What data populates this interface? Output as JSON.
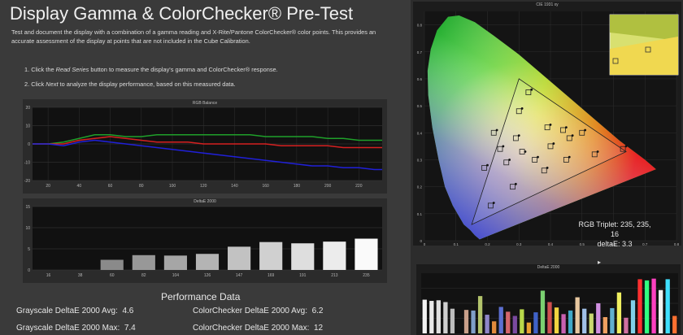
{
  "header": {
    "title": "Display Gamma & ColorChecker® Pre-Test",
    "intro": "Test and document the display with a combination of a gamma reading and X-Rite/Pantone ColorChecker® color points.  This provides an accurate assessment of the display at points that are not included in the Cube Calibration.",
    "step1_prefix": "1. Click the ",
    "step1_link": "Read Series",
    "step1_suffix": " button to measure the display's gamma and ColorChecker® response.",
    "step2_prefix": "2. Click ",
    "step2_link": "Next",
    "step2_suffix": " to analyze the display performance, based on this measured data."
  },
  "chart_data": [
    {
      "type": "line",
      "title": "RGB Balance",
      "x": [
        10,
        20,
        30,
        40,
        50,
        60,
        70,
        80,
        90,
        100,
        110,
        120,
        130,
        140,
        150,
        160,
        170,
        180,
        190,
        200,
        210,
        220,
        230,
        235
      ],
      "x_ticks": [
        "20",
        "40",
        "60",
        "80",
        "100",
        "120",
        "140",
        "160",
        "180",
        "200",
        "220"
      ],
      "ylim": [
        -20,
        20
      ],
      "y_ticks": [
        "20",
        "10",
        "0",
        "-10",
        "-20"
      ],
      "series": [
        {
          "color": "#1fa02a",
          "values": [
            0,
            0,
            1,
            3,
            5,
            5,
            4,
            4,
            5,
            5,
            5,
            5,
            5,
            5,
            5,
            4,
            4,
            4,
            4,
            3,
            3,
            2,
            2,
            2
          ]
        },
        {
          "color": "#d62020",
          "values": [
            0,
            0,
            0,
            2,
            3,
            4,
            3,
            2,
            1,
            1,
            1,
            0,
            0,
            0,
            0,
            0,
            -1,
            -1,
            -1,
            -1,
            -2,
            -2,
            -2,
            -2
          ]
        },
        {
          "color": "#2020d8",
          "values": [
            0,
            0,
            -1,
            1,
            2,
            1,
            0,
            -1,
            -2,
            -3,
            -4,
            -5,
            -6,
            -7,
            -8,
            -9,
            -10,
            -11,
            -12,
            -12,
            -13,
            -13,
            -14,
            -14
          ]
        }
      ],
      "grid": true
    },
    {
      "type": "bar",
      "title": "DeltaE 2000",
      "categories": [
        "16",
        "38",
        "60",
        "82",
        "104",
        "126",
        "147",
        "169",
        "191",
        "213",
        "235"
      ],
      "values": [
        0.0,
        0.0,
        2.4,
        3.5,
        3.4,
        3.8,
        5.5,
        6.6,
        6.3,
        6.7,
        7.4
      ],
      "ylim": [
        0,
        15
      ],
      "y_ticks": [
        "15",
        "10",
        "5",
        "0"
      ]
    },
    {
      "type": "scatter",
      "title": "CIE 1931 xy",
      "x_ticks": [
        "0",
        "0.1",
        "0.2",
        "0.3",
        "0.4",
        "0.5",
        "0.6",
        "0.7",
        "0.8"
      ],
      "y_ticks": [
        "0.8",
        "0.7",
        "0.6",
        "0.5",
        "0.4",
        "0.3",
        "0.2",
        "0.1",
        "0"
      ],
      "xlim": [
        0,
        0.8
      ],
      "ylim": [
        0,
        0.85
      ],
      "gamut_triangle": [
        [
          0.64,
          0.33
        ],
        [
          0.3,
          0.6
        ],
        [
          0.15,
          0.06
        ]
      ],
      "targets": [
        [
          0.31,
          0.33
        ],
        [
          0.4,
          0.35
        ],
        [
          0.26,
          0.29
        ],
        [
          0.22,
          0.4
        ],
        [
          0.3,
          0.48
        ],
        [
          0.39,
          0.42
        ],
        [
          0.46,
          0.38
        ],
        [
          0.54,
          0.32
        ],
        [
          0.63,
          0.34
        ],
        [
          0.28,
          0.2
        ],
        [
          0.21,
          0.13
        ],
        [
          0.35,
          0.3
        ],
        [
          0.44,
          0.41
        ],
        [
          0.33,
          0.55
        ],
        [
          0.24,
          0.34
        ],
        [
          0.19,
          0.27
        ],
        [
          0.45,
          0.3
        ],
        [
          0.5,
          0.4
        ],
        [
          0.38,
          0.26
        ],
        [
          0.29,
          0.38
        ]
      ],
      "measured": [
        [
          0.32,
          0.33
        ],
        [
          0.41,
          0.36
        ],
        [
          0.27,
          0.3
        ],
        [
          0.23,
          0.41
        ],
        [
          0.31,
          0.49
        ],
        [
          0.4,
          0.43
        ],
        [
          0.47,
          0.39
        ],
        [
          0.55,
          0.33
        ],
        [
          0.64,
          0.35
        ],
        [
          0.29,
          0.21
        ],
        [
          0.22,
          0.14
        ],
        [
          0.36,
          0.31
        ],
        [
          0.45,
          0.42
        ],
        [
          0.34,
          0.56
        ],
        [
          0.25,
          0.35
        ],
        [
          0.2,
          0.28
        ],
        [
          0.46,
          0.31
        ],
        [
          0.51,
          0.41
        ],
        [
          0.39,
          0.27
        ],
        [
          0.3,
          0.39
        ]
      ]
    },
    {
      "type": "bar",
      "title": "DeltaE 2000",
      "values": [
        5.6,
        5.4,
        5.5,
        5.2,
        4.1,
        0,
        3.9,
        3.8,
        6.2,
        3.1,
        2.0,
        4.4,
        3.6,
        2.9,
        4.0,
        1.8,
        3.5,
        7.1,
        5.2,
        4.3,
        3.2,
        3.8,
        6.0,
        4.1,
        3.3,
        5.0,
        2.7,
        4.2,
        6.8,
        2.6,
        5.5,
        9.0,
        8.8,
        9.1,
        7.2,
        9.0,
        2.9
      ],
      "colors": [
        "#f2f2f2",
        "#e8e8e8",
        "#dedede",
        "#cfcfcf",
        "#bdbdbd",
        "#333333",
        "#c9a08a",
        "#7f9fc9",
        "#b3c46c",
        "#8f86c8",
        "#e08a3c",
        "#5c6fd0",
        "#d4666c",
        "#7a4aa0",
        "#b8d84a",
        "#e8a030",
        "#4062c8",
        "#7ad070",
        "#d05050",
        "#f0d440",
        "#c860b0",
        "#40a8c8",
        "#e8c8a0",
        "#a0c0e8",
        "#c8d870",
        "#d090e0",
        "#f0a060",
        "#60b0d0",
        "#f0f060",
        "#d070a0",
        "#80d0e8",
        "#ff3030",
        "#30ff80",
        "#ff40c0",
        "#f0f0f0",
        "#40e0ff",
        "#ff7030"
      ],
      "ylim": [
        0,
        10
      ]
    }
  ],
  "rgb_balance_colors": {
    "red": "#d62020",
    "green": "#1fa02a",
    "blue": "#2020d8"
  },
  "readout": {
    "triplet": "RGB Triplet: 235, 235, 16",
    "deltae": "deltaE: 3.3"
  },
  "performance": {
    "title": "Performance Data",
    "gs_avg_label": "Grayscale DeltaE 2000 Avg:",
    "gs_avg_value": "4.6",
    "cc_avg_label": "ColorChecker DeltaE 2000 Avg:",
    "cc_avg_value": "6.2",
    "gs_max_label": "Grayscale DeltaE 2000 Max:",
    "gs_max_value": "7.4",
    "cc_max_label": "ColorChecker DeltaE 2000 Max:",
    "cc_max_value": "12"
  }
}
